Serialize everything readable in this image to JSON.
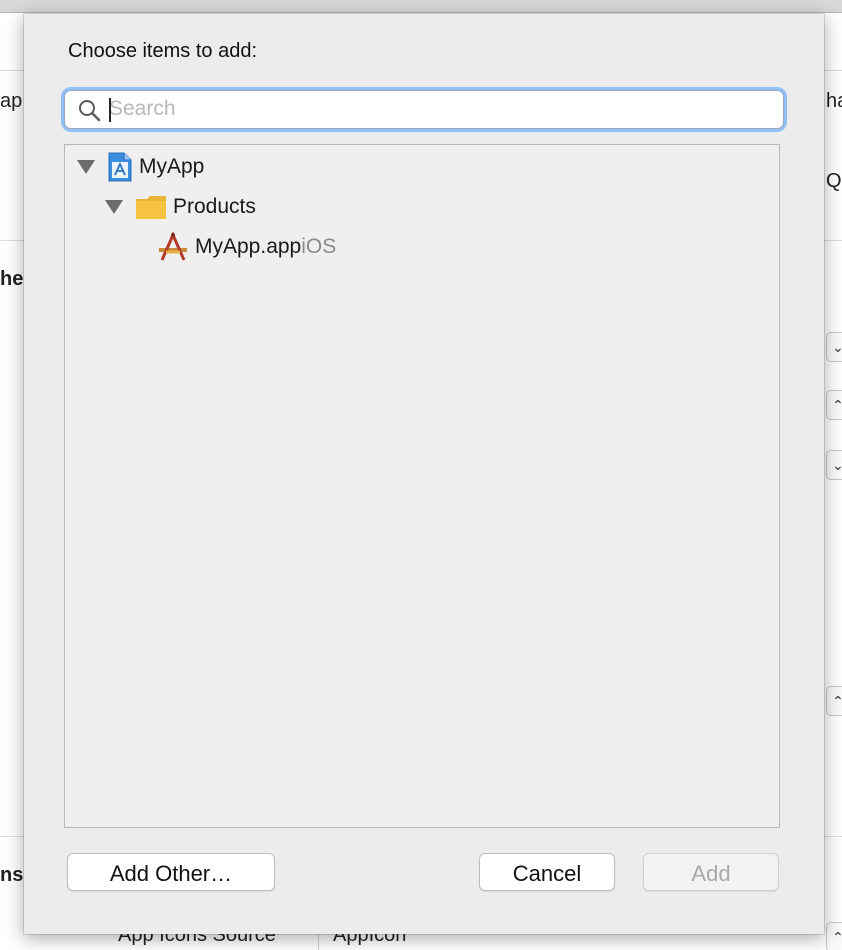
{
  "background": {
    "left_fragments": [
      "ap",
      "her",
      "ns"
    ],
    "right_fragments": [
      "ha",
      "QL"
    ],
    "bottom_label": "App Icons Source",
    "bottom_value": "AppIcon"
  },
  "dialog": {
    "title": "Choose items to add:",
    "search": {
      "placeholder": "Search",
      "value": ""
    },
    "tree": [
      {
        "label": "MyApp",
        "suffix": "",
        "icon": "xcode-project-icon",
        "expanded": true,
        "level": 0
      },
      {
        "label": "Products",
        "suffix": "",
        "icon": "folder-icon",
        "expanded": true,
        "level": 1
      },
      {
        "label": "MyApp.app",
        "suffix": "iOS",
        "icon": "app-product-icon",
        "expanded": false,
        "level": 2
      }
    ],
    "buttons": {
      "add_other": "Add Other…",
      "cancel": "Cancel",
      "add": "Add"
    }
  },
  "colors": {
    "focus_ring": "#90c0f6",
    "folder": "#f5c242",
    "project_icon": "#3b8de0"
  }
}
